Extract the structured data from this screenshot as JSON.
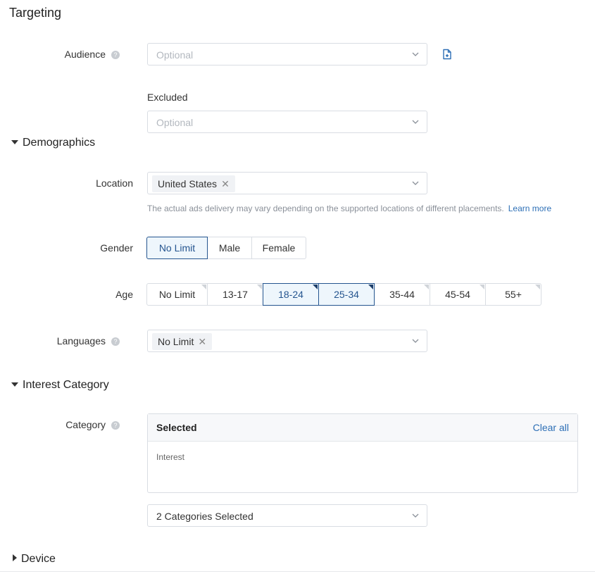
{
  "title": "Targeting",
  "audience": {
    "label": "Audience",
    "placeholder": "Optional"
  },
  "excluded": {
    "label": "Excluded",
    "placeholder": "Optional"
  },
  "sections": {
    "demographics": "Demographics",
    "interest": "Interest Category",
    "device": "Device"
  },
  "location": {
    "label": "Location",
    "tag": "United States",
    "hint": "The actual ads delivery may vary depending on the supported locations of different placements.",
    "learn_more": "Learn more"
  },
  "gender": {
    "label": "Gender",
    "options": [
      "No Limit",
      "Male",
      "Female"
    ],
    "selected": "No Limit"
  },
  "age": {
    "label": "Age",
    "options": [
      "No Limit",
      "13-17",
      "18-24",
      "25-34",
      "35-44",
      "45-54",
      "55+"
    ],
    "selected": [
      "18-24",
      "25-34"
    ]
  },
  "languages": {
    "label": "Languages",
    "tag": "No Limit"
  },
  "category": {
    "label": "Category",
    "panel_title": "Selected",
    "clear_all": "Clear all",
    "item": "Interest",
    "dropdown_value": "2 Categories Selected"
  },
  "colors": {
    "accent": "#25558f",
    "link": "#2d6fb6",
    "active_bg": "#eef6fc"
  },
  "icons": {
    "help": "help-icon",
    "add_audience": "add-file-icon",
    "chevron": "chevron-down-icon",
    "close": "close-icon"
  }
}
